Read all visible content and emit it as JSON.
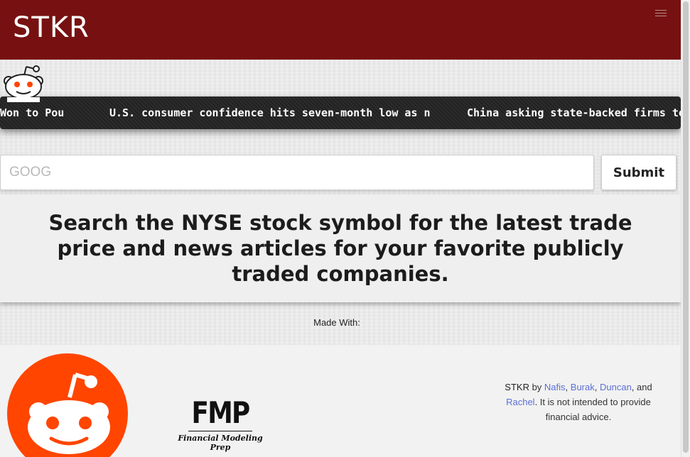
{
  "header": {
    "brand": "STKR",
    "menu_icon": "hamburger-icon",
    "bg_color": "#771111"
  },
  "ticker": {
    "icon": "reddit-icon",
    "items": [
      "Won to Pou",
      "U.S. consumer confidence hits seven-month low as n",
      "China asking state-backed firms to"
    ]
  },
  "search": {
    "placeholder": "GOOG",
    "value": "",
    "submit_label": "Submit"
  },
  "hero": {
    "text": "Search the NYSE stock symbol for the latest trade price and news articles for your favorite publicly traded companies."
  },
  "footer": {
    "made_with": "Made With:",
    "logos": [
      "reddit-logo",
      "fmp-logo"
    ],
    "fmp_big": "FMP",
    "fmp_sub": "Financial Modeling Prep",
    "credits": {
      "brand": "STKR",
      "by": " by ",
      "authors": [
        "Nafis",
        "Burak",
        "Duncan",
        "Rachel"
      ],
      "sep1": ", ",
      "sep2": ", ",
      "sep3": ", and ",
      "suffix": ". It is not intended to provide financial advice."
    }
  },
  "colors": {
    "accent": "#771111",
    "link": "#5b6fd6",
    "reddit": "#ff4500"
  }
}
